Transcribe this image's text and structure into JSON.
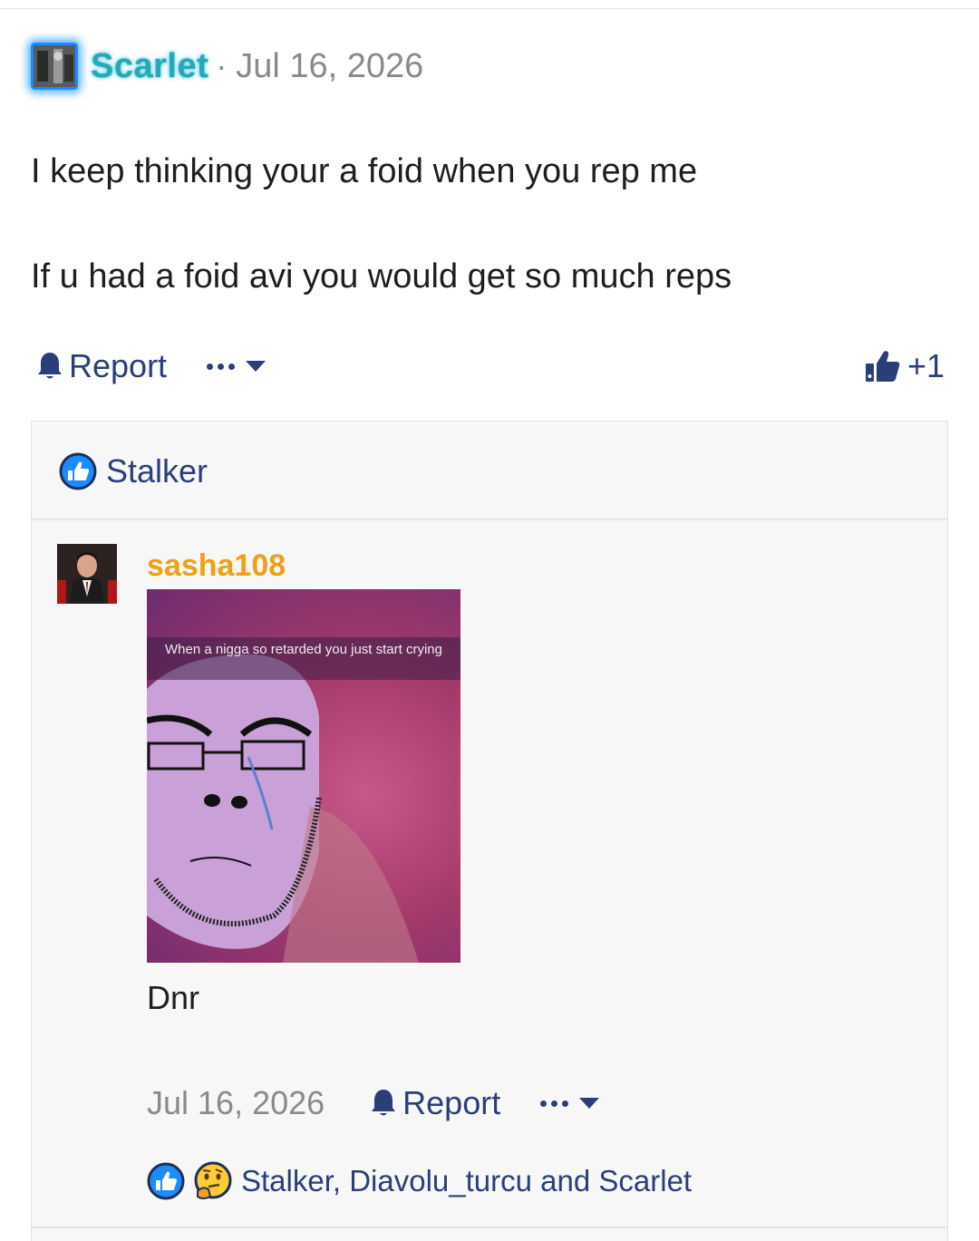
{
  "post": {
    "username": "Scarlet",
    "separator": "·",
    "date": "Jul 16, 2026",
    "lines": [
      "I keep thinking your a foid when you rep me",
      "If u had a foid avi you would get so much reps"
    ],
    "report_label": "Report",
    "like_count": "+1",
    "accent_color": "#27a9b5"
  },
  "reactions_bar": {
    "reactor": "Stalker",
    "icon": "like-icon"
  },
  "reply": {
    "username": "sasha108",
    "username_color": "#f0a014",
    "image_caption": "When a nigga so retarded you just start crying",
    "text": "Dnr",
    "date": "Jul 16, 2026",
    "report_label": "Report",
    "reactors": "Stalker, Diavolu_turcu and Scarlet",
    "reaction_icons": [
      "like-icon",
      "thinking-face-icon"
    ]
  },
  "colors": {
    "link": "#2a3f7a",
    "muted": "#8a8a8a",
    "like_blue": "#1a8cff"
  }
}
